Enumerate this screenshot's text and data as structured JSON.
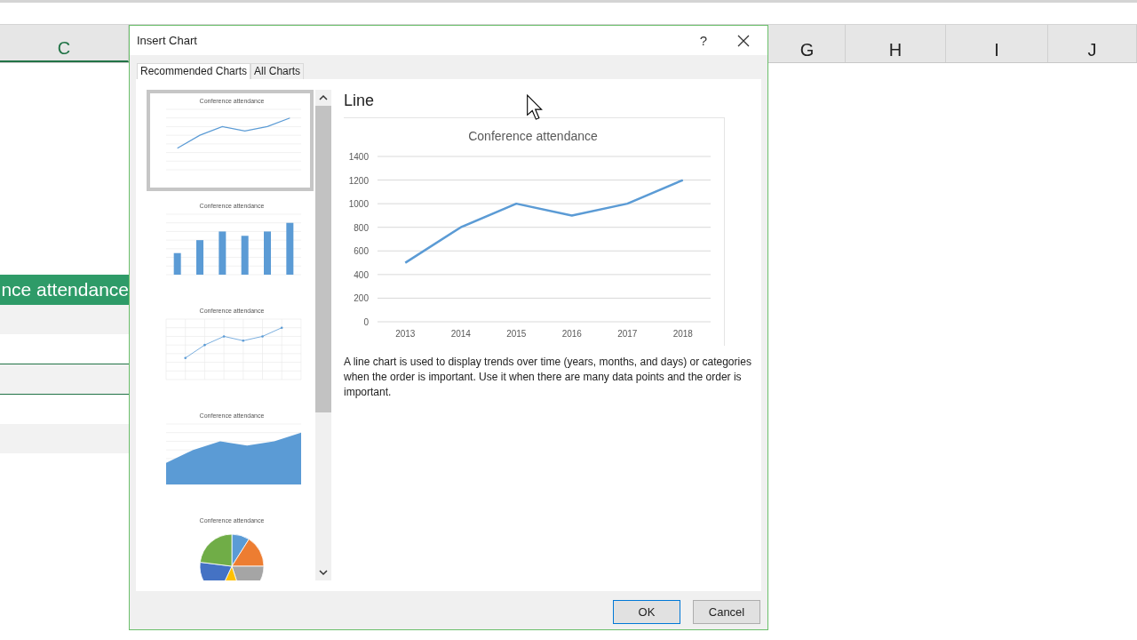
{
  "spreadsheet": {
    "column_headers": [
      {
        "label": "C",
        "selected": true
      },
      {
        "label": "G",
        "selected": false
      },
      {
        "label": "H",
        "selected": false
      },
      {
        "label": "I",
        "selected": false
      },
      {
        "label": "J",
        "selected": false
      }
    ],
    "title_cell": "nce attendance"
  },
  "dialog": {
    "title": "Insert Chart",
    "help": "?",
    "tabs": [
      {
        "label": "Recommended Charts",
        "selected": true
      },
      {
        "label": "All Charts",
        "selected": false
      }
    ],
    "thumbnails": [
      {
        "kind": "line",
        "title": "Conference attendance",
        "selected": true
      },
      {
        "kind": "column",
        "title": "Conference attendance",
        "selected": false
      },
      {
        "kind": "scatter",
        "title": "Conference attendance",
        "selected": false
      },
      {
        "kind": "area",
        "title": "Conference attendance",
        "selected": false
      },
      {
        "kind": "pie",
        "title": "Conference attendance",
        "selected": false
      }
    ],
    "preview": {
      "heading": "Line",
      "chart_data": {
        "type": "line",
        "title": "Conference attendance",
        "categories": [
          "2013",
          "2014",
          "2015",
          "2016",
          "2017",
          "2018"
        ],
        "series": [
          {
            "color": "#5b9bd5",
            "values": [
              500,
              800,
              1000,
              900,
              1000,
              1200
            ]
          }
        ],
        "grid": true,
        "ylim": [
          0,
          1400
        ],
        "yticks": [
          0,
          200,
          400,
          600,
          800,
          1000,
          1200,
          1400
        ]
      },
      "description": "A line chart is used to display trends over time (years, months, and days) or categories when the order is important. Use it when there are many data points and the order is important."
    },
    "buttons": [
      {
        "label": "OK",
        "default": true
      },
      {
        "label": "Cancel",
        "default": false
      }
    ]
  }
}
